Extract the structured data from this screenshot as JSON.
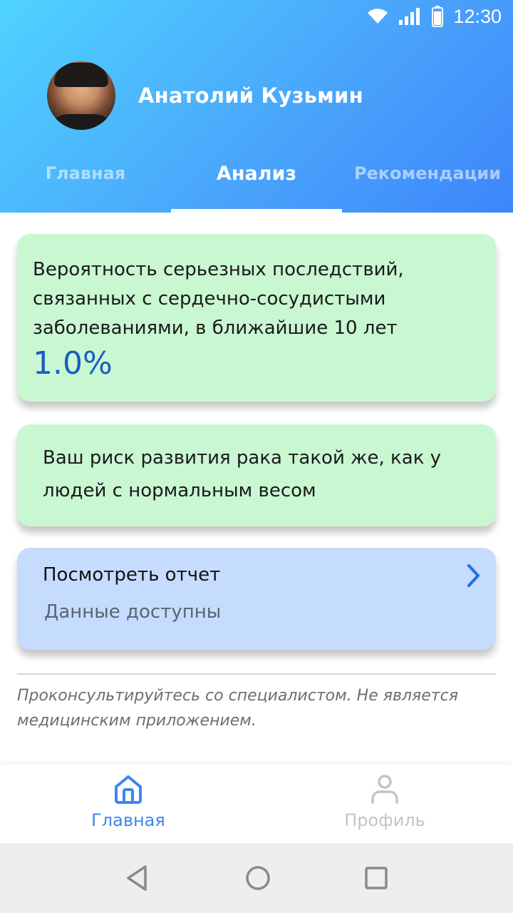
{
  "status_bar": {
    "time": "12:30"
  },
  "user": {
    "name": "Анатолий Кузьмин"
  },
  "tabs": [
    {
      "label": "Главная",
      "active": false
    },
    {
      "label": "Анализ",
      "active": true
    },
    {
      "label": "Рекомендации",
      "active": false
    }
  ],
  "cards": {
    "cardio": {
      "text": "Вероятность серьезных последствий, связанных с сердечно-сосудистыми заболеваниями, в ближайшие 10 лет",
      "value": "1.0%"
    },
    "cancer": {
      "text": "Ваш риск развития рака такой же, как у людей с нормальным весом"
    },
    "report": {
      "title": "Посмотреть отчет",
      "subtitle": "Данные доступны"
    }
  },
  "disclaimer": "Проконсультируйтесь со специалистом. Не является медицинским приложением.",
  "bottom_nav": [
    {
      "label": "Главная",
      "icon": "home-icon",
      "active": true
    },
    {
      "label": "Профиль",
      "icon": "person-icon",
      "active": false
    }
  ],
  "colors": {
    "accent": "#3d86f0",
    "value": "#1b5cc4",
    "green_card": "#c9f7d2",
    "blue_card": "#c6dcff"
  }
}
